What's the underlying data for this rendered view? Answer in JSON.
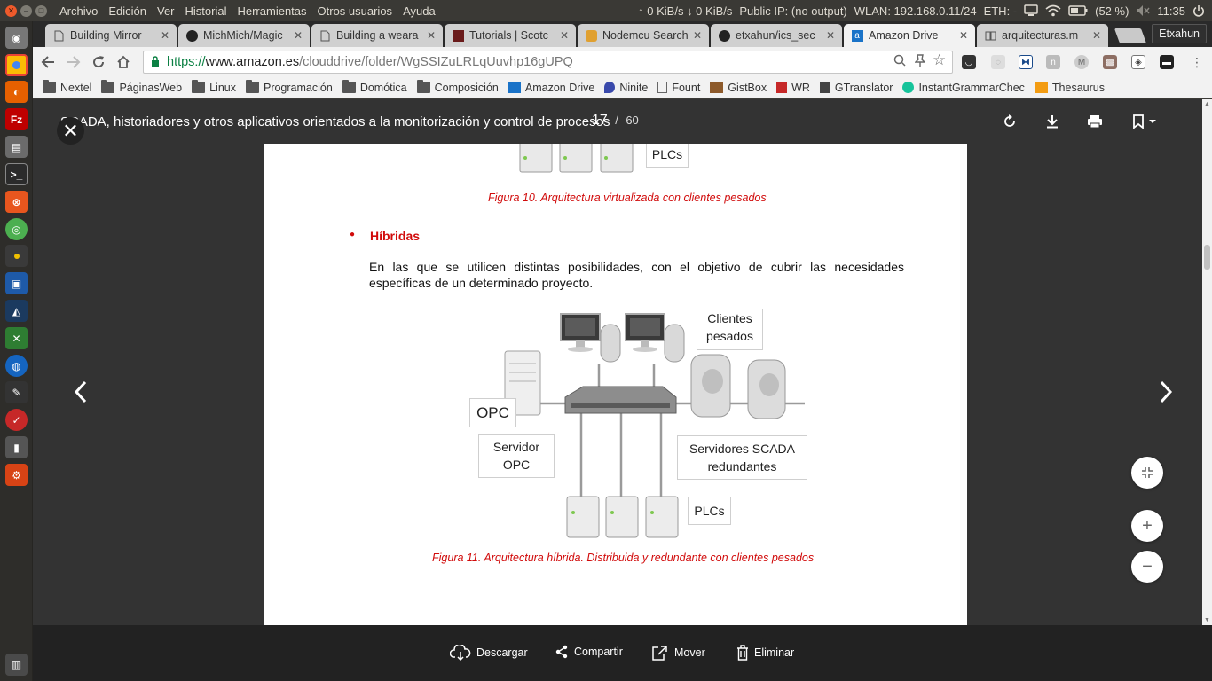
{
  "system_panel": {
    "menu": [
      "Archivo",
      "Edición",
      "Ver",
      "Historial",
      "Herramientas",
      "Otros usuarios",
      "Ayuda"
    ],
    "net_speed": "↑ 0 KiB/s ↓ 0 KiB/s",
    "public_ip": "Public IP: (no output)",
    "wlan": "WLAN: 192.168.0.11/24",
    "eth": "ETH: -",
    "battery": "(52 %)",
    "clock": "11:35"
  },
  "tabs": [
    {
      "title": "Building Mirror",
      "icon": "document-icon"
    },
    {
      "title": "MichMich/Magic",
      "icon": "github-icon"
    },
    {
      "title": "Building a weara",
      "icon": "document-icon"
    },
    {
      "title": "Tutorials | Scotc",
      "icon": "scotch-icon"
    },
    {
      "title": "Nodemcu Search",
      "icon": "nodemcu-icon"
    },
    {
      "title": "etxahun/ics_sec",
      "icon": "github-icon"
    },
    {
      "title": "Amazon Drive",
      "icon": "amazon-icon"
    },
    {
      "title": "arquitecturas.m",
      "icon": "book-icon"
    }
  ],
  "profile_name": "Etxahun",
  "address_bar": {
    "scheme": "https://",
    "host": "www.amazon.es",
    "path": "/clouddrive/folder/WgSSIZuLRLqUuvhp16gUPQ"
  },
  "bookmarks": [
    {
      "label": "Nextel",
      "icon": "folder-icon"
    },
    {
      "label": "PáginasWeb",
      "icon": "folder-icon"
    },
    {
      "label": "Linux",
      "icon": "folder-icon"
    },
    {
      "label": "Programación",
      "icon": "folder-icon"
    },
    {
      "label": "Domótica",
      "icon": "folder-icon"
    },
    {
      "label": "Composición",
      "icon": "folder-icon"
    },
    {
      "label": "Amazon Drive",
      "icon": "amazon-icon"
    },
    {
      "label": "Ninite",
      "icon": "ninite-icon"
    },
    {
      "label": "Fount",
      "icon": "page-icon"
    },
    {
      "label": "GistBox",
      "icon": "gistbox-icon"
    },
    {
      "label": "WR",
      "icon": "wr-icon"
    },
    {
      "label": "GTranslator",
      "icon": "translate-icon"
    },
    {
      "label": "InstantGrammarChec",
      "icon": "grammar-icon"
    },
    {
      "label": "Thesaurus",
      "icon": "thesaurus-icon"
    }
  ],
  "viewer": {
    "document_title": "SCADA, historiadores y otros aplicativos orientados a la monitorización y control de procesos",
    "current_page": "17",
    "page_separator": "/",
    "total_pages": "60"
  },
  "document": {
    "plcs_top_label": "PLCs",
    "figure10_caption": "Figura 10. Arquitectura virtualizada con clientes pesados",
    "bullet_heading": "Híbridas",
    "paragraph": "En las que se utilicen distintas posibilidades, con el objetivo de cubrir las necesidades específicas de un determinado proyecto.",
    "diagram": {
      "clients_label": "Clientes\npesados",
      "opc_label": "OPC",
      "opc_server_label": "Servidor\nOPC",
      "scada_servers_label": "Servidores SCADA\nredundantes",
      "plcs_label": "PLCs"
    },
    "figure11_caption": "Figura 11. Arquitectura híbrida. Distribuida y redundante con clientes pesados"
  },
  "actions": {
    "download": "Descargar",
    "share": "Compartir",
    "move": "Mover",
    "delete": "Eliminar"
  },
  "colors": {
    "caption_red": "#d10b0b",
    "viewer_bg": "#333333",
    "bottom_bar": "#222222",
    "url_green": "#0b8043"
  }
}
